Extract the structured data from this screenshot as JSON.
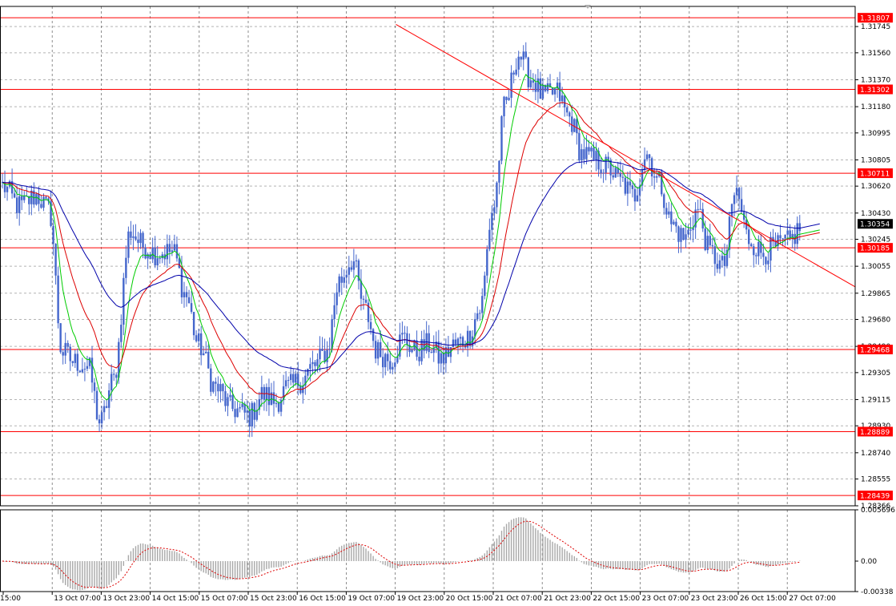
{
  "chart_data": {
    "type": "candlestick",
    "main": {
      "price_range": [
        1.28366,
        1.31887
      ],
      "y_ticks": [
        "1.31745",
        "1.31560",
        "1.31370",
        "1.31180",
        "1.30995",
        "1.30805",
        "1.30620",
        "1.30430",
        "1.30245",
        "1.30055",
        "1.29865",
        "1.29680",
        "1.29490",
        "1.29305",
        "1.29115",
        "1.28930",
        "1.28740",
        "1.28555",
        "1.28366"
      ],
      "levels": [
        {
          "value": 1.31807,
          "label": "1.31807"
        },
        {
          "value": 1.31302,
          "label": "1.31302"
        },
        {
          "value": 1.30711,
          "label": "1.30711"
        },
        {
          "value": 1.30185,
          "label": "1.30185"
        },
        {
          "value": 1.29468,
          "label": "1.29468"
        },
        {
          "value": 1.28889,
          "label": "1.28889"
        },
        {
          "value": 1.28439,
          "label": "1.28439"
        }
      ],
      "current_price": {
        "value": 1.30354,
        "label": "1.30354"
      },
      "trendline": {
        "from": {
          "bar": 0.463,
          "price": 1.3176
        },
        "to": {
          "bar": 1.0,
          "price": 1.2991
        }
      },
      "close_anchors": [
        [
          0,
          1.3062
        ],
        [
          0.02,
          1.3048
        ],
        [
          0.04,
          1.3055
        ],
        [
          0.055,
          1.3045
        ],
        [
          0.07,
          1.2945
        ],
        [
          0.085,
          1.2938
        ],
        [
          0.1,
          1.2935
        ],
        [
          0.115,
          1.2895
        ],
        [
          0.13,
          1.2925
        ],
        [
          0.15,
          1.303
        ],
        [
          0.165,
          1.302
        ],
        [
          0.18,
          1.3015
        ],
        [
          0.2,
          1.3016
        ],
        [
          0.215,
          1.2985
        ],
        [
          0.23,
          1.295
        ],
        [
          0.25,
          1.292
        ],
        [
          0.27,
          1.2905
        ],
        [
          0.29,
          1.29
        ],
        [
          0.305,
          1.2915
        ],
        [
          0.32,
          1.291
        ],
        [
          0.335,
          1.292
        ],
        [
          0.35,
          1.2925
        ],
        [
          0.365,
          1.2935
        ],
        [
          0.38,
          1.2945
        ],
        [
          0.395,
          1.2995
        ],
        [
          0.41,
          1.301
        ],
        [
          0.425,
          1.2975
        ],
        [
          0.44,
          1.2945
        ],
        [
          0.455,
          1.294
        ],
        [
          0.47,
          1.2955
        ],
        [
          0.485,
          1.2945
        ],
        [
          0.5,
          1.295
        ],
        [
          0.515,
          1.294
        ],
        [
          0.53,
          1.295
        ],
        [
          0.545,
          1.2955
        ],
        [
          0.56,
          1.2975
        ],
        [
          0.575,
          1.3045
        ],
        [
          0.59,
          1.312
        ],
        [
          0.605,
          1.3155
        ],
        [
          0.62,
          1.3138
        ],
        [
          0.635,
          1.3125
        ],
        [
          0.65,
          1.3128
        ],
        [
          0.665,
          1.311
        ],
        [
          0.68,
          1.3085
        ],
        [
          0.695,
          1.308
        ],
        [
          0.71,
          1.3075
        ],
        [
          0.725,
          1.3065
        ],
        [
          0.74,
          1.3055
        ],
        [
          0.755,
          1.3085
        ],
        [
          0.77,
          1.3065
        ],
        [
          0.785,
          1.3035
        ],
        [
          0.8,
          1.3025
        ],
        [
          0.815,
          1.3045
        ],
        [
          0.83,
          1.3015
        ],
        [
          0.845,
          1.3005
        ],
        [
          0.86,
          1.3058
        ],
        [
          0.875,
          1.3025
        ],
        [
          0.89,
          1.3015
        ],
        [
          0.905,
          1.3018
        ],
        [
          0.92,
          1.3022
        ],
        [
          0.94,
          1.3035
        ],
        [
          1.0,
          1.3035
        ]
      ],
      "moving_averages": [
        {
          "color": "#00cc00",
          "period": 8
        },
        {
          "color": "#dd0000",
          "period": 21
        },
        {
          "color": "#0000aa",
          "period": 55
        }
      ]
    },
    "sub": {
      "range": [
        -0.00338,
        0.005696
      ],
      "y_ticks": [
        "0.005696",
        "0.00",
        "-0.00338"
      ],
      "signal_color": "#dd0000",
      "hist_color": "#a8a8a8"
    },
    "x_ticks": [
      "15:00",
      "13 Oct 07:00",
      "13 Oct 23:00",
      "14 Oct 15:00",
      "15 Oct 07:00",
      "15 Oct 23:00",
      "16 Oct 15:00",
      "19 Oct 07:00",
      "19 Oct 23:00",
      "20 Oct 15:00",
      "21 Oct 07:00",
      "21 Oct 23:00",
      "22 Oct 15:00",
      "23 Oct 07:00",
      "23 Oct 23:00",
      "26 Oct 15:00",
      "27 Oct 07:00"
    ],
    "colors": {
      "candle": "#4466cc",
      "grid": "#b4b4b4",
      "level": "#ff0000",
      "trend": "#ff0000",
      "current_bg": "#000000"
    }
  }
}
